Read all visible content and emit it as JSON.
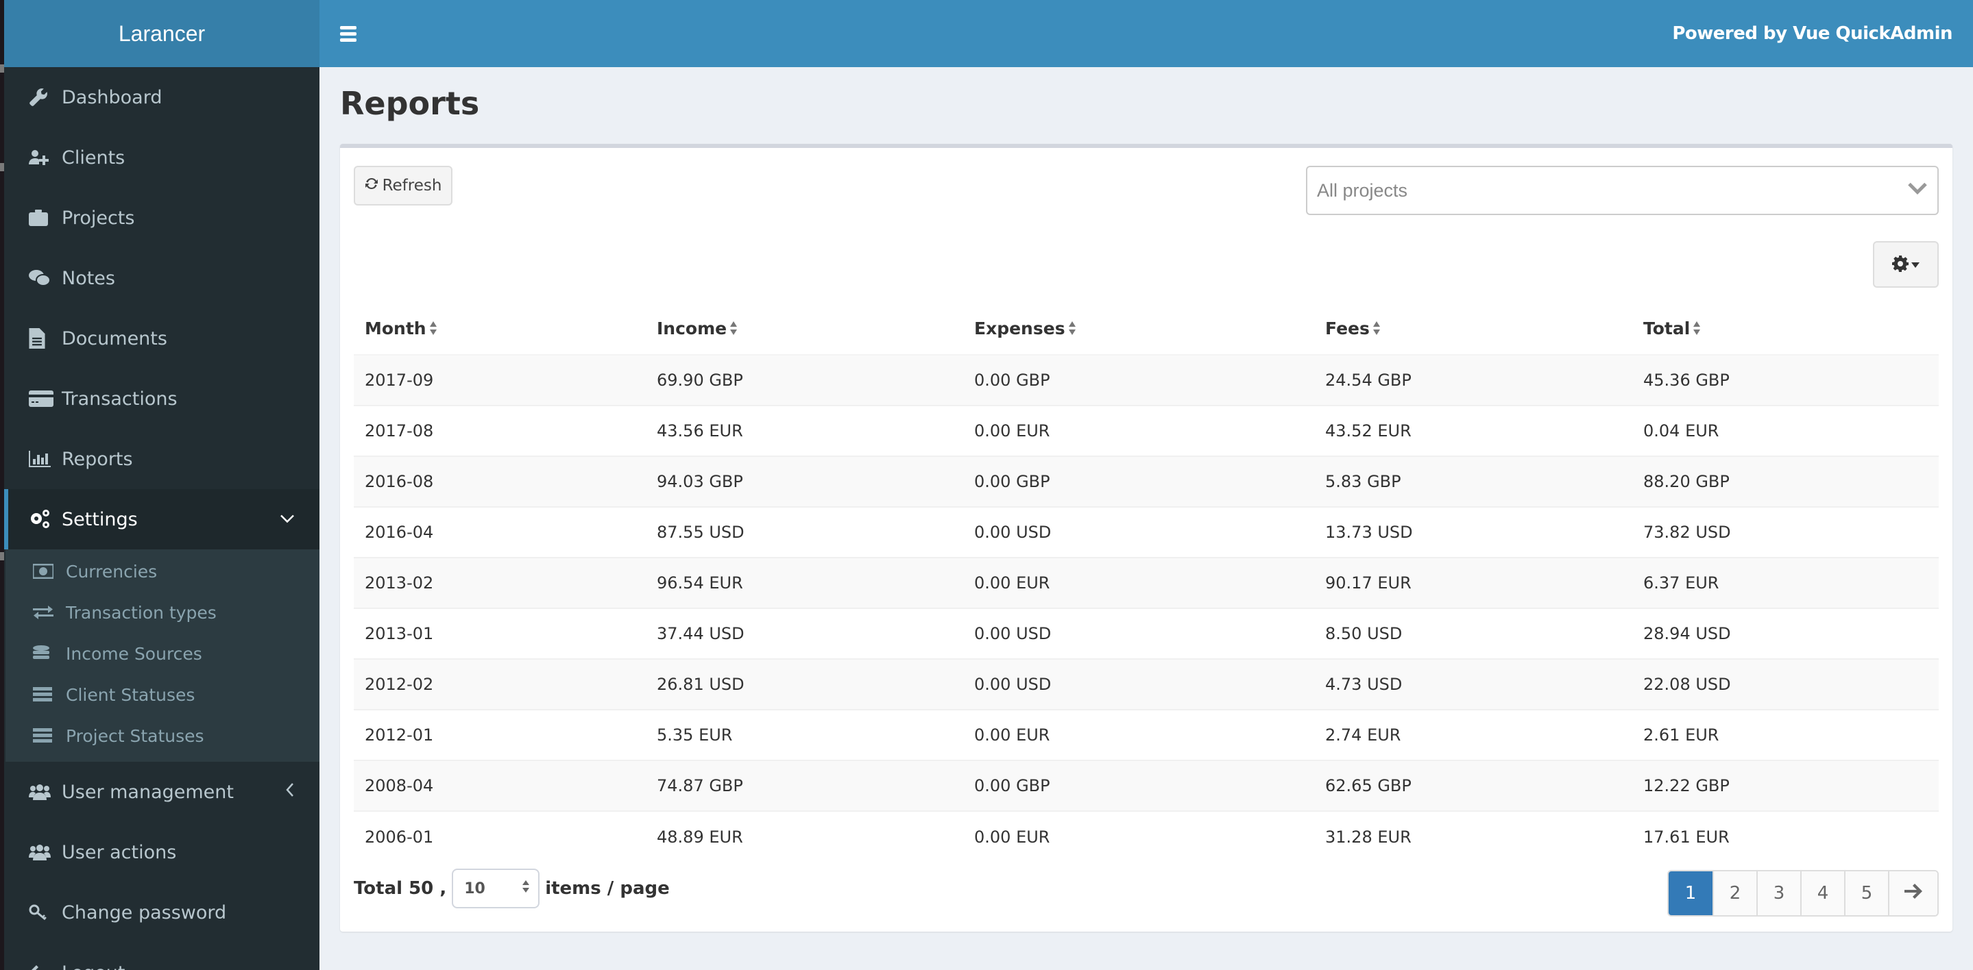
{
  "app": {
    "brand": "Larancer",
    "powered_by": "Powered by Vue QuickAdmin"
  },
  "sidebar": {
    "items": [
      {
        "label": "Dashboard",
        "icon": "wrench-icon"
      },
      {
        "label": "Clients",
        "icon": "user-plus-icon"
      },
      {
        "label": "Projects",
        "icon": "briefcase-icon"
      },
      {
        "label": "Notes",
        "icon": "wechat-icon"
      },
      {
        "label": "Documents",
        "icon": "file-text-icon"
      },
      {
        "label": "Transactions",
        "icon": "credit-card-icon"
      },
      {
        "label": "Reports",
        "icon": "bar-chart-icon"
      },
      {
        "label": "Settings",
        "icon": "cogs-icon",
        "active": true,
        "expanded": true
      }
    ],
    "settings_submenu": [
      {
        "label": "Currencies",
        "icon": "money-icon"
      },
      {
        "label": "Transaction types",
        "icon": "exchange-icon"
      },
      {
        "label": "Income Sources",
        "icon": "database-icon"
      },
      {
        "label": "Client Statuses",
        "icon": "server-icon"
      },
      {
        "label": "Project Statuses",
        "icon": "server-icon"
      }
    ],
    "bottom_items": [
      {
        "label": "User management",
        "icon": "users-icon",
        "collapsed": true
      },
      {
        "label": "User actions",
        "icon": "users-icon"
      },
      {
        "label": "Change password",
        "icon": "key-icon"
      },
      {
        "label": "Logout",
        "icon": "arrow-left-icon"
      }
    ]
  },
  "page": {
    "title": "Reports",
    "refresh_label": "Refresh",
    "project_select": {
      "selected": "All projects"
    }
  },
  "table": {
    "columns": [
      "Month",
      "Income",
      "Expenses",
      "Fees",
      "Total"
    ],
    "rows": [
      [
        "2017-09",
        "69.90 GBP",
        "0.00 GBP",
        "24.54 GBP",
        "45.36 GBP"
      ],
      [
        "2017-08",
        "43.56 EUR",
        "0.00 EUR",
        "43.52 EUR",
        "0.04 EUR"
      ],
      [
        "2016-08",
        "94.03 GBP",
        "0.00 GBP",
        "5.83 GBP",
        "88.20 GBP"
      ],
      [
        "2016-04",
        "87.55 USD",
        "0.00 USD",
        "13.73 USD",
        "73.82 USD"
      ],
      [
        "2013-02",
        "96.54 EUR",
        "0.00 EUR",
        "90.17 EUR",
        "6.37 EUR"
      ],
      [
        "2013-01",
        "37.44 USD",
        "0.00 USD",
        "8.50 USD",
        "28.94 USD"
      ],
      [
        "2012-02",
        "26.81 USD",
        "0.00 USD",
        "4.73 USD",
        "22.08 USD"
      ],
      [
        "2012-01",
        "5.35 EUR",
        "0.00 EUR",
        "2.74 EUR",
        "2.61 EUR"
      ],
      [
        "2008-04",
        "74.87 GBP",
        "0.00 GBP",
        "62.65 GBP",
        "12.22 GBP"
      ],
      [
        "2006-01",
        "48.89 EUR",
        "0.00 EUR",
        "31.28 EUR",
        "17.61 EUR"
      ]
    ]
  },
  "footer": {
    "total_label": "Total 50 ,",
    "per_page_value": "10",
    "per_page_suffix": "items / page"
  },
  "pagination": {
    "pages": [
      "1",
      "2",
      "3",
      "4",
      "5"
    ],
    "current": "1",
    "next_icon": "arrow-right-icon"
  },
  "colors": {
    "header_bg": "#3c8dbc",
    "logo_bg": "#367fa9",
    "sidebar_bg": "#222d32",
    "submenu_bg": "#2c3b41",
    "active_accent": "#3c8dbc",
    "pagination_active": "#337ab7",
    "content_bg": "#ecf0f5"
  }
}
